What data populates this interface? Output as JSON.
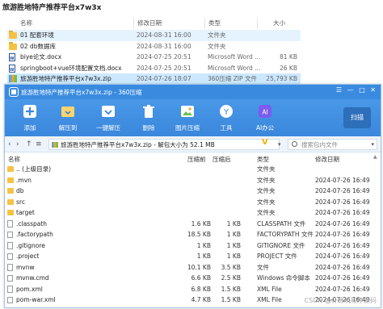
{
  "explorer": {
    "title": "旅游胜地特产推荐平台x7w3x",
    "columns": {
      "name": "名称",
      "date": "修改日期",
      "type": "类型",
      "size": "大小"
    },
    "rows": [
      {
        "name": "01 配套环境",
        "date": "2024-08-31 16:00",
        "type": "文件夹",
        "size": "",
        "icon": "folder-icon",
        "state": "hover"
      },
      {
        "name": "02 db数据库",
        "date": "2024-08-31 16:00",
        "type": "文件夹",
        "size": "",
        "icon": "folder-icon",
        "state": ""
      },
      {
        "name": "biye论文.docx",
        "date": "2024-07-25 20:51",
        "type": "Microsoft Word ...",
        "size": "81 KB",
        "icon": "word-icon",
        "state": ""
      },
      {
        "name": "springboot+vue环境配置文档.docx",
        "date": "2024-07-25 20:51",
        "type": "Microsoft Word ...",
        "size": "26 KB",
        "icon": "word-icon",
        "state": ""
      },
      {
        "name": "旅游胜地特产推荐平台x7w3x.zip",
        "date": "2024-07-26 18:07",
        "type": "360压缩 ZIP 文件",
        "size": "25,793 KB",
        "icon": "zip-icon",
        "state": "selected"
      }
    ]
  },
  "archive": {
    "title": "旅游胜地特产推荐平台x7w3x.zip - 360压缩",
    "toolbar": [
      {
        "label": "添加",
        "icon": "add-icon"
      },
      {
        "label": "解压到",
        "icon": "extract-to-icon"
      },
      {
        "label": "一键解压",
        "icon": "one-click-extract-icon"
      },
      {
        "label": "删除",
        "icon": "delete-icon"
      },
      {
        "label": "图片压缩",
        "icon": "image-compress-icon"
      },
      {
        "label": "工具",
        "icon": "tools-icon"
      },
      {
        "label": "AI办公",
        "icon": "ai-icon"
      }
    ],
    "scan_label": "扫描",
    "path": "旅游胜地特产推荐平台x7w3x.zip - 解包大小为 52.1 MB",
    "search_placeholder": "搜索包内文件",
    "columns": {
      "name": "名称",
      "size": "压缩前",
      "csize": "压缩后",
      "type": "类型",
      "date": "修改日期"
    },
    "rows": [
      {
        "name": ".. (上级目录)",
        "size": "",
        "csize": "",
        "type": "文件夹",
        "date": "",
        "kind": "folder"
      },
      {
        "name": ".mvn",
        "size": "",
        "csize": "",
        "type": "文件夹",
        "date": "2024-07-26 16:49",
        "kind": "folder"
      },
      {
        "name": "db",
        "size": "",
        "csize": "",
        "type": "文件夹",
        "date": "2024-07-26 16:49",
        "kind": "folder"
      },
      {
        "name": "src",
        "size": "",
        "csize": "",
        "type": "文件夹",
        "date": "2024-07-26 16:49",
        "kind": "folder"
      },
      {
        "name": "target",
        "size": "",
        "csize": "",
        "type": "文件夹",
        "date": "2024-07-26 16:49",
        "kind": "folder"
      },
      {
        "name": ".classpath",
        "size": "1.6 KB",
        "csize": "1 KB",
        "type": "CLASSPATH 文件",
        "date": "2024-07-26 16:49",
        "kind": "file"
      },
      {
        "name": ".factorypath",
        "size": "18.5 KB",
        "csize": "1 KB",
        "type": "FACTORYPATH 文件",
        "date": "2024-07-26 16:49",
        "kind": "file"
      },
      {
        "name": ".gitignore",
        "size": "1 KB",
        "csize": "1 KB",
        "type": "GITIGNORE 文件",
        "date": "2024-07-26 16:49",
        "kind": "file"
      },
      {
        "name": ".project",
        "size": "1 KB",
        "csize": "1 KB",
        "type": "PROJECT 文件",
        "date": "2024-07-26 16:49",
        "kind": "file"
      },
      {
        "name": "mvnw",
        "size": "10.1 KB",
        "csize": "3.5 KB",
        "type": "文件",
        "date": "2024-07-26 16:49",
        "kind": "file"
      },
      {
        "name": "mvnw.cmd",
        "size": "6.6 KB",
        "csize": "2.5 KB",
        "type": "Windows 命令脚本",
        "date": "2024-07-26 16:49",
        "kind": "file"
      },
      {
        "name": "pom.xml",
        "size": "6.8 KB",
        "csize": "1.5 KB",
        "type": "XML File",
        "date": "2024-07-26 16:49",
        "kind": "file"
      },
      {
        "name": "pom-war.xml",
        "size": "4.7 KB",
        "csize": "1.5 KB",
        "type": "XML File",
        "date": "2024-07-26 16:49",
        "kind": "file"
      }
    ]
  },
  "watermark": "CSDN @计算机程序源码",
  "colors": {
    "ribbon": "#3a87dc",
    "selected": "#cce8ff",
    "folder": "#f6c244"
  }
}
